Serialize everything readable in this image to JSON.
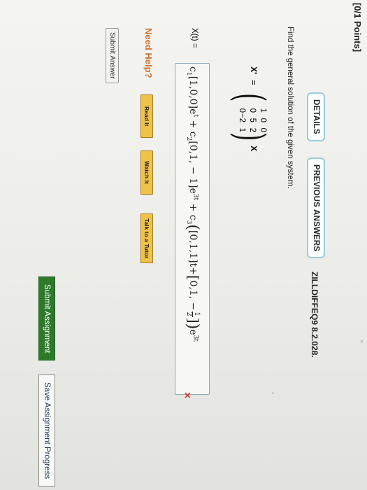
{
  "header": {
    "points": "[0/1 Points]",
    "details_label": "DETAILS",
    "previous_answers_label": "PREVIOUS ANSWERS",
    "problem_code": "ZILLDIFFEQ9 8.2.028."
  },
  "question": {
    "prompt": "Find the general solution of the given system.",
    "x_prime": "X'",
    "equals": "=",
    "matrix": [
      [
        "1",
        "0",
        "0"
      ],
      [
        "0",
        "5",
        "2"
      ],
      [
        "0",
        "−2",
        "1"
      ]
    ],
    "x_vec": "X"
  },
  "answer": {
    "lhs": "X(t) =",
    "c1": "c",
    "c1_sub": "1",
    "vec1": "[1,0,0]",
    "e1": "e",
    "e1_exp": "t",
    "plus1": "+",
    "c2": "c",
    "c2_sub": "2",
    "vec2": "[0,1, − 1]",
    "e2": "e",
    "e2_exp": "3t",
    "plus2": "+",
    "c3": "c",
    "c3_sub": "3",
    "vec3": "[0,1,1]t",
    "plus3": "+",
    "vec4_start": "0,1, −",
    "frac_num": "1",
    "frac_den": "2",
    "e3": "e",
    "e3_exp": "3t",
    "status": "×"
  },
  "help": {
    "label": "Need Help?",
    "read_it": "Read It",
    "watch_it": "Watch It",
    "talk_tutor": "Talk to a Tutor"
  },
  "footer": {
    "submit_answer": "Submit Answer",
    "submit_assignment": "Submit Assignment",
    "save_progress": "Save Assignment Progress"
  },
  "colors": {
    "accent_border": "#9ccbe0",
    "need_help": "#d0702c",
    "help_button": "#f1c24a",
    "submit_assignment": "#2c7a2a",
    "wrong": "#d9332a"
  }
}
